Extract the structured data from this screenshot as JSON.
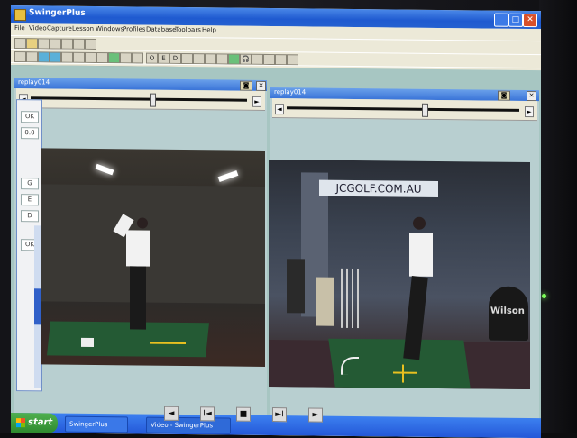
{
  "window": {
    "title": "SwingerPlus"
  },
  "menu": [
    "File",
    "Video",
    "Capture",
    "Lesson",
    "Windows",
    "Profiles",
    "Database",
    "Toolbars",
    "Help"
  ],
  "toolbar_text": [
    "O",
    "E",
    "D"
  ],
  "panels": [
    {
      "title": "replay014",
      "progress": 0.55
    },
    {
      "title": "replay014",
      "progress": 0.58
    }
  ],
  "left_tools": [
    "OK",
    "0.0",
    "G",
    "E",
    "D",
    "OK"
  ],
  "video_right": {
    "banner": "JCGOLF.COM.AU",
    "brand": "Wilson"
  },
  "taskbar": {
    "start_label": "start",
    "tasks": [
      "SwingerPlus",
      "Video - SwingerPlus"
    ]
  },
  "playback": [
    "◄",
    "I◄",
    "■",
    "►I",
    "►"
  ],
  "colors": {
    "titlebar": "#2460d0",
    "workspace": "#a7c6c2",
    "taskbar": "#2458d8",
    "start": "#2e8a2e"
  }
}
